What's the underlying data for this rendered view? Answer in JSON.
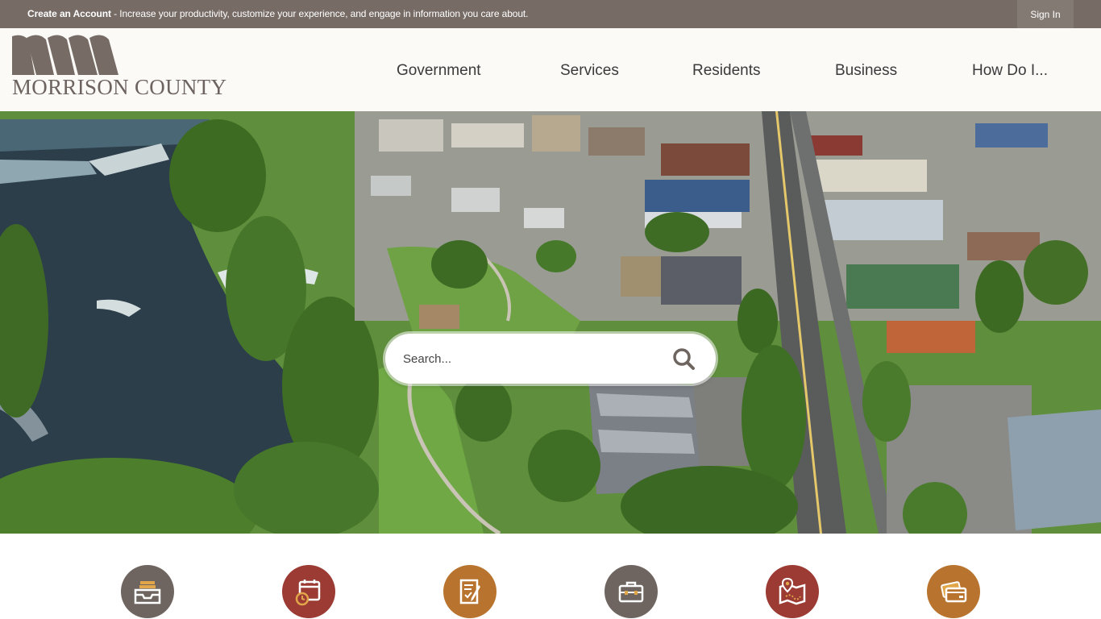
{
  "topbar": {
    "account_link": "Create an Account",
    "account_message": " - Increase your productivity, customize your experience, and engage in information you care about.",
    "sign_in": "Sign In"
  },
  "header": {
    "logo_text": "MORRISON COUNTY",
    "nav": [
      {
        "label": "Government"
      },
      {
        "label": "Services"
      },
      {
        "label": "Residents"
      },
      {
        "label": "Business"
      },
      {
        "label": "How Do I..."
      }
    ]
  },
  "search": {
    "placeholder": "Search..."
  },
  "quick_links": [
    {
      "icon": "inbox-tray-icon",
      "color": "#6e6560"
    },
    {
      "icon": "calendar-clock-icon",
      "color": "#9b3b34"
    },
    {
      "icon": "document-pen-icon",
      "color": "#b8742f"
    },
    {
      "icon": "briefcase-icon",
      "color": "#6e6560"
    },
    {
      "icon": "map-pin-icon",
      "color": "#9b3b34"
    },
    {
      "icon": "credit-card-icon",
      "color": "#b8742f"
    }
  ],
  "colors": {
    "topbar_bg": "#766b65",
    "header_bg": "#fcfaf7",
    "logo": "#6d645f"
  }
}
